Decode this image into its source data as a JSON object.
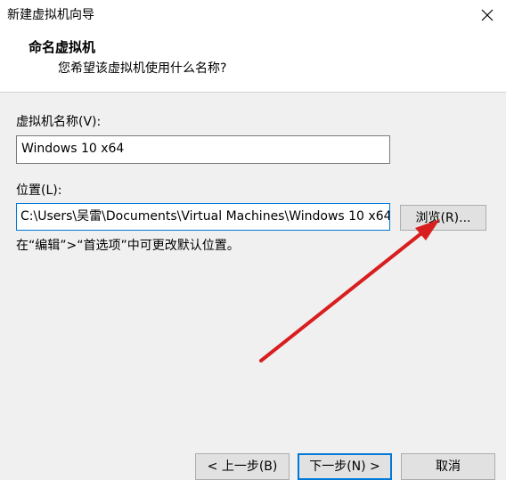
{
  "window": {
    "title": "新建虚拟机向导",
    "close_glyph": "✕"
  },
  "header": {
    "heading": "命名虚拟机",
    "subheading": "您希望该虚拟机使用什么名称?"
  },
  "form": {
    "name_label": "虚拟机名称(V):",
    "name_value": "Windows 10 x64",
    "location_label": "位置(L):",
    "location_value": "C:\\Users\\吴雷\\Documents\\Virtual Machines\\Windows 10 x64",
    "browse_label": "浏览(R)...",
    "hint": "在“编辑”>“首选项”中可更改默认位置。"
  },
  "footer": {
    "back_label": "< 上一步(B)",
    "next_label": "下一步(N) >",
    "cancel_label": "取消"
  },
  "colors": {
    "annotation_arrow": "#d81e1e",
    "focus_border": "#0078d7"
  }
}
